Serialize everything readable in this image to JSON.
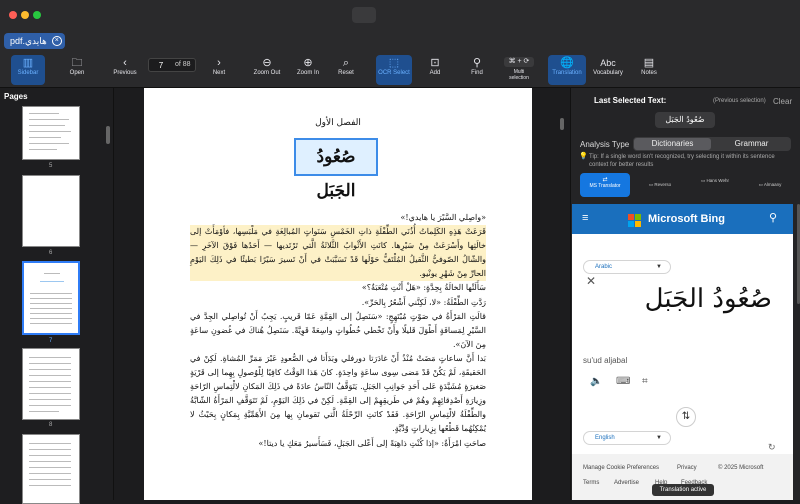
{
  "window": {
    "tab_label": "pdf.هايدي",
    "tab_close": "×"
  },
  "toolbar": {
    "sidebar": "Sidebar",
    "open": "Open",
    "previous": "Previous",
    "page_current": "7",
    "page_of": "of 88",
    "next": "Next",
    "zoom_out": "Zoom Out",
    "zoom_in": "Zoom In",
    "reset": "Reset",
    "ocr_select": "OCR Select",
    "add": "Add",
    "find": "Find",
    "multi_selection_shortcut": "⌘ + ⟳",
    "multi_selection": "Multi selection",
    "translation": "Translation",
    "vocabulary": "Vocabulary",
    "notes": "Notes"
  },
  "sidebar": {
    "title": "Pages",
    "thumbnails": [
      {
        "num": "5"
      },
      {
        "num": "6"
      },
      {
        "num": "7"
      },
      {
        "num": "8"
      },
      {
        "num": ""
      }
    ]
  },
  "document": {
    "chapter": "الفصل الأول",
    "heading": "صُعُودُ الجَبَل",
    "paragraphs": [
      "«واصِلي السَّيْرَ يا هايدي!»",
      "قَرَعَتْ هَذِهِ الكَلِماتُ أُذُنَي الطِّفْلَةِ ذاتِ الخَمْسِ سَنَواتٍ المُبالِغَةِ في مَلْبَسِها، فأوْمَأَتْ إلى خالَتِها وأَسْرَعَتْ مِنْ سَيْرِها. كانَتِ الأَثْوابُ الثَّلاثَةُ الَّتي تَرْتَديها — أَحَدُها فَوْقَ الآخَرِ — والشّالُ الصّوفيُّ الثَّقيلُ المُلْتَفُّ حَوْلَها قَدْ تَسَبَّبَتْ في أَنْ تَسيرَ سَيْرًا بَطيئًا في ذَلِكَ اليَوْمِ الحارِّ مِنْ شَهْرِ يونْيو.",
      "سَأَلَتْها الخالَةُ بِحِدَّةٍ: «هَلْ أَنْتِ مُتْعَبَةٌ؟»",
      "رَدَّتِ الطِّفْلَةُ: «لا، لَكِنَّني أَشْعُرُ بِالحَرِّ».",
      "قالَتِ المَرْأَةُ في صَوْتٍ مُبْتَهِجٍ: «سَنَصِلُ إلى القِمَّةِ عَمّا قَريبٍ. يَجِبُ أَنْ تُواصِلي الجِدَّ في السَّيْرِ لِمَسافَةٍ أَطْوَلَ قَليلًا وأَنْ تَخْطي خُطُواتٍ واسِعَةً قَوِيَّةً. سَنَصِلُ هُناكَ في غُضونِ ساعَةٍ مِنَ الآنَ».",
      "بَدا أَنَّ ساعاتٍ مَضَتْ مُنْذُ أَنْ غادَرَتا دورفلي وبَدَأَتا في الصُّعودِ عَبْرَ مَمَرِّ المُشاةِ. لَكِنْ في الحَقيقَةِ، لَمْ يَكُنْ قَدْ مَضى سِوى ساعَةٍ واحِدَةٍ. كانَ هَذا الوَقْتُ كافِيًا لِلْوُصولِ بِهِما إلى قَرْيَةٍ صَغيرَةٍ مُشَيَّدَةٍ عَلى أَحَدِ جَوانِبِ الجَبَلِ. يَتَوَقَّفُ النّاسُ عادَةً في ذَلِكَ المَكانِ لالْتِماسِ الرّاحَةِ وزِيارَةِ أَصْدِقائِهِمْ وهُمْ في طَريقِهِمْ إلى القِمَّةِ. لَكِنْ في ذَلِكَ اليَوْمِ، لَمْ تَتَوَقَّفِ المَرْأَةُ الشّابَّةُ والطِّفْلَةُ لالْتِماسِ الرّاحَةِ. فَقَدْ كانَتِ الرِّحْلَةُ الَّتي تَقومانِ بِها مِنَ الأَهَمِّيَّةِ بِمَكانٍ بِحَيْثُ لا يُمْكِنُهُما قَطْعُها بِزِياراتٍ وُدِّيَّةٍ.",
      "صاحَتِ امْرَأَةٌ: «إذا كُنْتِ ذاهِبَةً إلى أَعْلى الجَبَلِ، فَسَأَسيرُ مَعَكِ يا ديتا!»"
    ]
  },
  "panel": {
    "last_selected_title": "Last Selected Text:",
    "previous_selection": "(Previous selection)",
    "clear": "Clear",
    "selected_text": "صُعُودُ الجَبَل",
    "analysis_type_label": "Analysis Type",
    "dictionaries": "Dictionaries",
    "grammar": "Grammar",
    "tip": "Tip: If a single word isn't recognized, try selecting it within its sentence context for better results",
    "services": [
      {
        "label": "MS Translator"
      },
      {
        "label": "Reverso"
      },
      {
        "label": "Hans Wehr"
      },
      {
        "label": "Almaany"
      }
    ]
  },
  "bing": {
    "title": "Microsoft Bing",
    "source_lang": "Arabic",
    "source_text": "صُعُودُ الجَبَل",
    "transliteration": "su'ud aljabal",
    "target_lang": "English",
    "footer": {
      "cookies": "Manage Cookie Preferences",
      "privacy": "Privacy",
      "copyright": "© 2025 Microsoft",
      "terms": "Terms",
      "advertise": "Advertise",
      "help": "Help",
      "feedback": "Feedback"
    }
  },
  "status": {
    "toast": "Translation active"
  }
}
